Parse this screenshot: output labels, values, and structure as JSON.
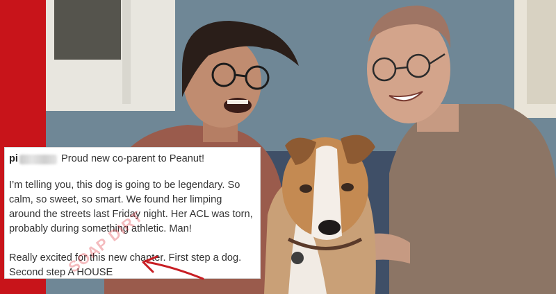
{
  "caption": {
    "username_prefix": "pi",
    "headline": "Proud new co-parent to Peanut!",
    "paragraph_1": "I’m telling you, this dog is going to be legendary. So calm, so sweet, so smart. We found her limping around the streets last Friday night. Her ACL was torn, probably during something athletic. Man!",
    "paragraph_2": "Really excited for this new chapter. First step a dog. Second step A HOUSE"
  },
  "watermark_text": "SOAP DIRT",
  "colors": {
    "brand_red": "#c8141a",
    "wall": "#6f8796",
    "arrow": "#c81e24"
  }
}
